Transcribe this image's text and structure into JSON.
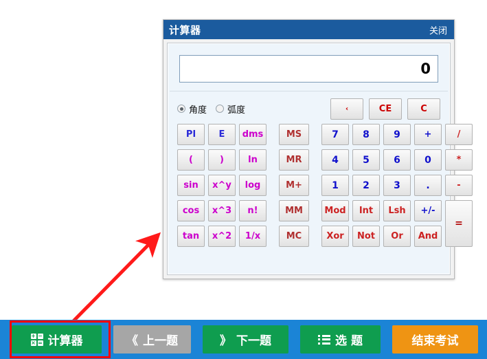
{
  "calculator": {
    "title": "计算器",
    "close_label": "关闭",
    "display_value": "0",
    "modes": [
      {
        "label": "角度",
        "selected": true
      },
      {
        "label": "弧度",
        "selected": false
      }
    ],
    "clear_buttons": [
      {
        "label": "‹",
        "name": "backspace"
      },
      {
        "label": "CE",
        "name": "clear-entry"
      },
      {
        "label": "C",
        "name": "clear"
      }
    ],
    "keys": [
      {
        "label": "PI",
        "style": "c-const"
      },
      {
        "label": "E",
        "style": "c-const"
      },
      {
        "label": "dms",
        "style": "c-fn"
      },
      {
        "label": "MS",
        "style": "c-mem"
      },
      {
        "label": "7",
        "style": "c-num"
      },
      {
        "label": "8",
        "style": "c-num"
      },
      {
        "label": "9",
        "style": "c-num"
      },
      {
        "label": "+",
        "style": "c-opb"
      },
      {
        "label": "/",
        "style": "c-op"
      },
      {
        "label": "(",
        "style": "c-fn"
      },
      {
        "label": ")",
        "style": "c-fn"
      },
      {
        "label": "ln",
        "style": "c-fn"
      },
      {
        "label": "MR",
        "style": "c-mem"
      },
      {
        "label": "4",
        "style": "c-num"
      },
      {
        "label": "5",
        "style": "c-num"
      },
      {
        "label": "6",
        "style": "c-num"
      },
      {
        "label": "0",
        "style": "c-num"
      },
      {
        "label": "*",
        "style": "c-op"
      },
      {
        "label": "sin",
        "style": "c-fn"
      },
      {
        "label": "x^y",
        "style": "c-fn"
      },
      {
        "label": "log",
        "style": "c-fn"
      },
      {
        "label": "M+",
        "style": "c-mem"
      },
      {
        "label": "1",
        "style": "c-num"
      },
      {
        "label": "2",
        "style": "c-num"
      },
      {
        "label": "3",
        "style": "c-num"
      },
      {
        "label": ".",
        "style": "c-num"
      },
      {
        "label": "-",
        "style": "c-op"
      },
      {
        "label": "cos",
        "style": "c-fn"
      },
      {
        "label": "x^3",
        "style": "c-fn"
      },
      {
        "label": "n!",
        "style": "c-fn"
      },
      {
        "label": "MM",
        "style": "c-mem"
      },
      {
        "label": "Mod",
        "style": "c-op"
      },
      {
        "label": "Int",
        "style": "c-op"
      },
      {
        "label": "Lsh",
        "style": "c-op"
      },
      {
        "label": "+/-",
        "style": "c-opb"
      },
      {
        "label": "tan",
        "style": "c-fn"
      },
      {
        "label": "x^2",
        "style": "c-fn"
      },
      {
        "label": "1/x",
        "style": "c-fn"
      },
      {
        "label": "MC",
        "style": "c-mem"
      },
      {
        "label": "Xor",
        "style": "c-op"
      },
      {
        "label": "Not",
        "style": "c-op"
      },
      {
        "label": "Or",
        "style": "c-op"
      },
      {
        "label": "And",
        "style": "c-op"
      }
    ],
    "equals_label": "="
  },
  "toolbar": {
    "calculator_label": "计算器",
    "prev_label": "上一题",
    "next_label": "下一题",
    "select_label": "选 题",
    "finish_label": "结束考试",
    "prev_chevron": "《",
    "next_chevron": "》",
    "calc_icon_glyphs": [
      "+",
      "−",
      "×",
      "="
    ]
  },
  "colors": {
    "titlebar": "#1b5b9e",
    "toolbar_bg": "#1b84d6",
    "green": "#0f9d4f",
    "gray": "#a6a6a6",
    "orange": "#ef9413",
    "highlight": "#ff0000"
  }
}
